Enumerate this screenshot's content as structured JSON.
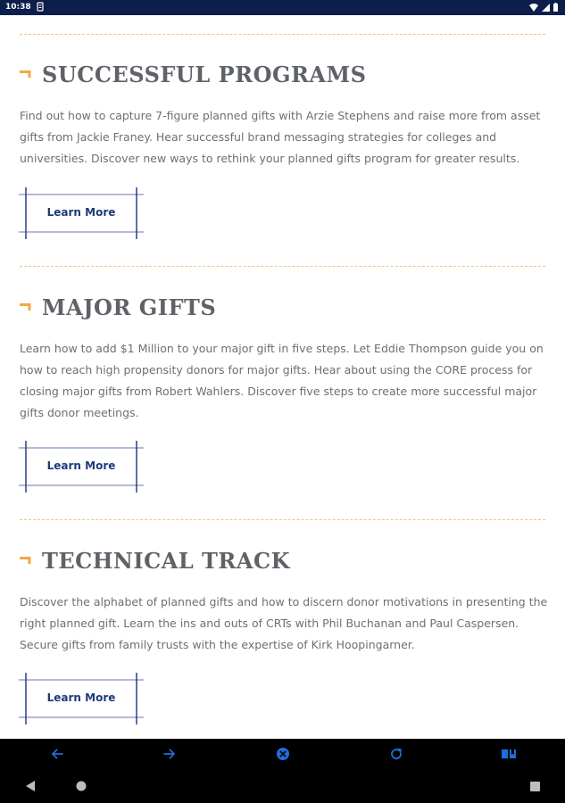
{
  "status_bar": {
    "time": "10:38",
    "icons": [
      "notification-icon",
      "wifi-icon",
      "signal-icon",
      "battery-icon"
    ]
  },
  "sections": [
    {
      "title": "SUCCESSFUL PROGRAMS",
      "body": "Find out how to capture 7-figure planned gifts with Arzie Stephens and raise more from asset gifts from Jackie Franey. Hear successful brand messaging strategies for colleges and universities. Discover new ways to rethink your planned gifts program for greater results.",
      "button_label": "Learn More"
    },
    {
      "title": "MAJOR GIFTS",
      "body": "Learn how to add $1 Million to your major gift in five steps. Let Eddie Thompson guide you on how to reach high propensity donors for major gifts. Hear about using the CORE process for closing major gifts from Robert Wahlers. Discover five steps to create more successful major gifts donor meetings.",
      "button_label": "Learn More"
    },
    {
      "title": "TECHNICAL TRACK",
      "body": "Discover the alphabet of planned gifts and how to discern donor motivations in presenting the right planned gift. Learn the ins and outs of CRTs with Phil Buchanan and Paul Caspersen. Secure gifts from family trusts with the expertise of Kirk Hoopingarner.",
      "button_label": "Learn More"
    }
  ],
  "browser_toolbar": {
    "icons": [
      "back-arrow-icon",
      "forward-arrow-icon",
      "close-circle-icon",
      "refresh-icon",
      "bookmarks-icon"
    ]
  },
  "system_nav": {
    "icons": [
      "nav-back-icon",
      "nav-home-icon",
      "nav-recents-icon"
    ]
  },
  "colors": {
    "status_bar_bg": "#0c1e4a",
    "accent_orange": "#f5a742",
    "divider_orange": "#f2c28a",
    "title_gray": "#5f6368",
    "body_gray": "#6c6f73",
    "button_text_navy": "#1f3a7a",
    "button_frame_navy": "#2a3f84",
    "browser_icon_blue": "#1e6fd9"
  }
}
